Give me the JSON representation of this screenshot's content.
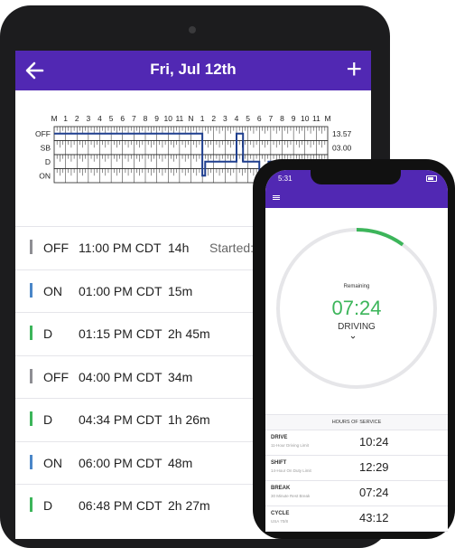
{
  "tablet": {
    "title": "Fri, Jul 12th",
    "hour_labels": [
      "M",
      "1",
      "2",
      "3",
      "4",
      "5",
      "6",
      "7",
      "8",
      "9",
      "10",
      "11",
      "N",
      "1",
      "2",
      "3",
      "4",
      "5",
      "6",
      "7",
      "8",
      "9",
      "10",
      "11",
      "M"
    ],
    "status_labels": [
      "OFF",
      "SB",
      "D",
      "ON"
    ],
    "totals": [
      "13.57",
      "03.00"
    ],
    "log": [
      {
        "status": "OFF",
        "time": "11:00 PM CDT",
        "duration": "14h",
        "extra": "Started: 7/",
        "color": "#8e8e93"
      },
      {
        "status": "ON",
        "time": "01:00 PM CDT",
        "duration": "15m",
        "extra": "",
        "color": "#4a86c8"
      },
      {
        "status": "D",
        "time": "01:15 PM CDT",
        "duration": "2h 45m",
        "extra": "",
        "color": "#3cb55a"
      },
      {
        "status": "OFF",
        "time": "04:00 PM CDT",
        "duration": "34m",
        "extra": "",
        "color": "#8e8e93"
      },
      {
        "status": "D",
        "time": "04:34 PM CDT",
        "duration": "1h 26m",
        "extra": "",
        "color": "#3cb55a"
      },
      {
        "status": "ON",
        "time": "06:00 PM CDT",
        "duration": "48m",
        "extra": "",
        "color": "#4a86c8"
      },
      {
        "status": "D",
        "time": "06:48 PM CDT",
        "duration": "2h 27m",
        "extra": "",
        "color": "#3cb55a"
      }
    ],
    "icons": {
      "back": "arrow-left-icon",
      "add": "plus-icon"
    },
    "add_label": "+"
  },
  "phone": {
    "status_time": "5:31",
    "gauge": {
      "label": "Remaining",
      "time": "07:24",
      "status": "DRIVING",
      "progress": 0.1
    },
    "hos_title": "HOURS OF SERVICE",
    "hos": [
      {
        "name": "DRIVE",
        "sub": "11-Hour Driving Limit",
        "value": "10:24"
      },
      {
        "name": "SHIFT",
        "sub": "14-Hour On Duty Limit",
        "value": "12:29"
      },
      {
        "name": "BREAK",
        "sub": "30 Minute Rest Break",
        "value": "07:24"
      },
      {
        "name": "CYCLE",
        "sub": "USA 70/8",
        "value": "43:12"
      }
    ]
  },
  "colors": {
    "brand": "#5128b3",
    "driving": "#3cb55a",
    "on_duty": "#4a86c8",
    "off_duty": "#8e8e93",
    "log_line": "#1f3f8f"
  }
}
